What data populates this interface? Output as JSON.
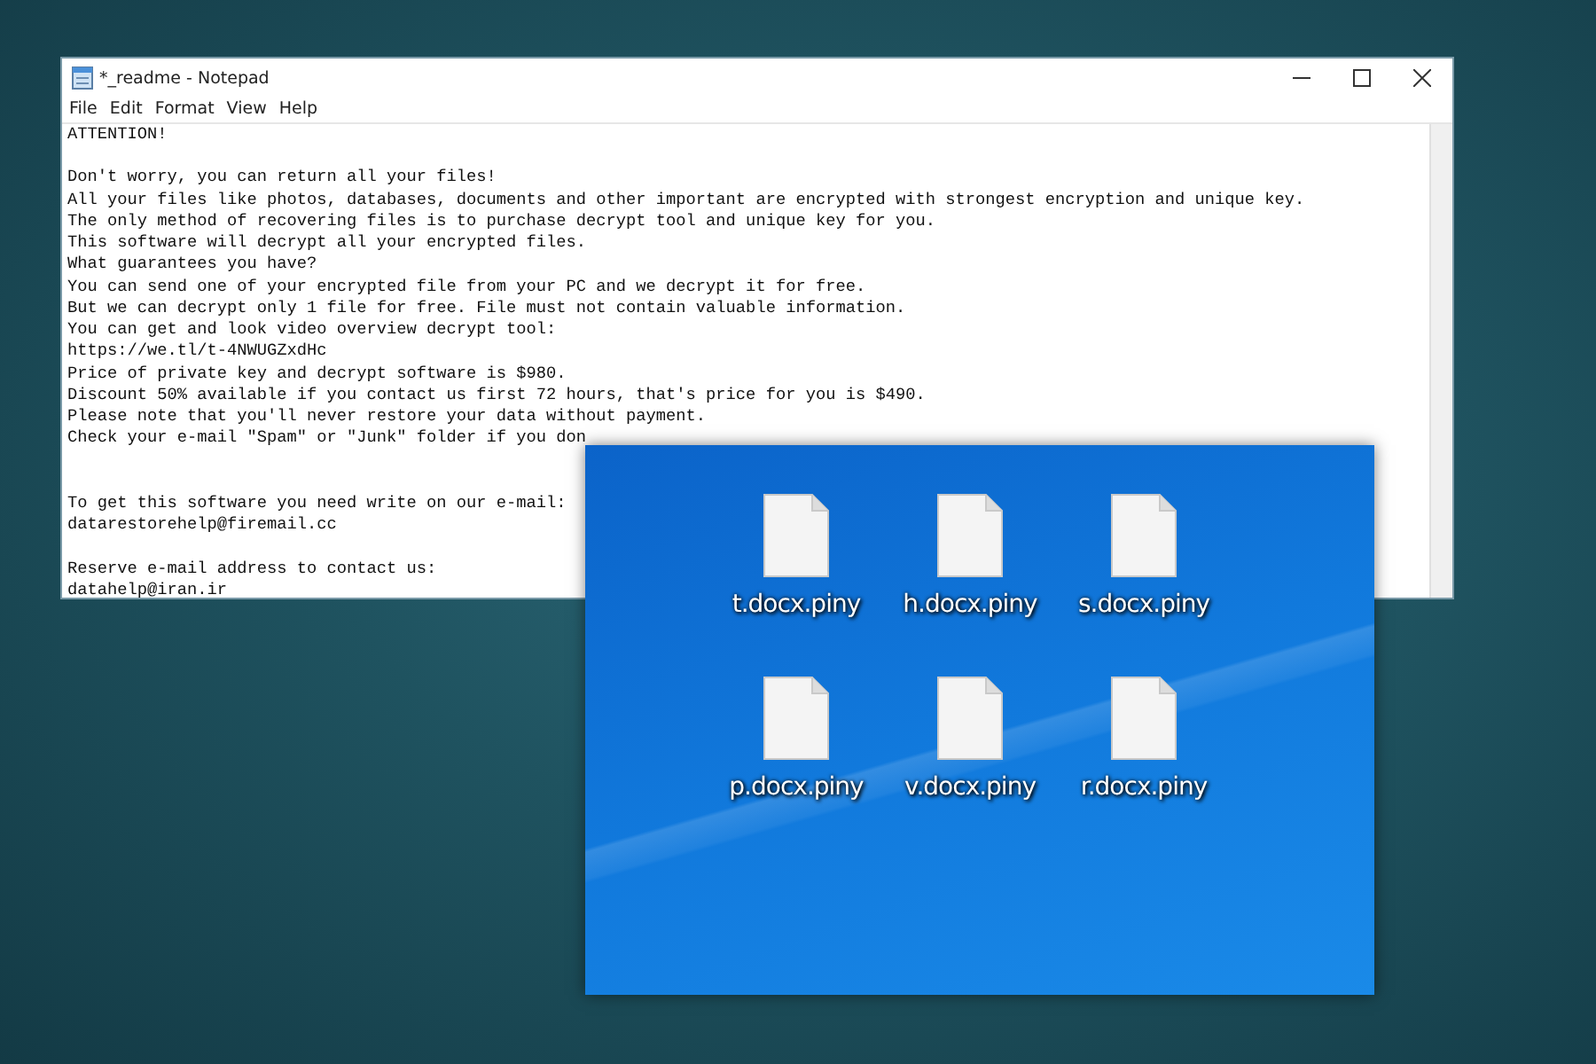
{
  "notepad": {
    "title": "*_readme - Notepad",
    "menu": [
      "File",
      "Edit",
      "Format",
      "View",
      "Help"
    ],
    "blocks": [
      {
        "lines": [
          "ATTENTION!"
        ]
      },
      {
        "lines": [
          "Don't worry, you can return all your files!",
          "All your files like photos, databases, documents and other important are encrypted with strongest encryption and unique key.",
          "The only method of recovering files is to purchase decrypt tool and unique key for you.",
          "This software will decrypt all your encrypted files.",
          "What guarantees you have?",
          "You can send one of your encrypted file from your PC and we decrypt it for free.",
          "But we can decrypt only 1 file for free. File must not contain valuable information.",
          "You can get and look video overview decrypt tool:",
          "https://we.tl/t-4NWUGZxdHc",
          "Price of private key and decrypt software is $980.",
          "Discount 50% available if you contact us first 72 hours, that's price for you is $490.",
          "Please note that you'll never restore your data without payment.",
          "Check your e-mail \"Spam\" or \"Junk\" folder if you don"
        ]
      },
      {
        "lines": [
          "To get this software you need write on our e-mail:",
          "datarestorehelp@firemail.cc"
        ]
      },
      {
        "lines": [
          "Reserve e-mail address to contact us:",
          "datahelp@iran.ir"
        ]
      }
    ]
  },
  "desktop": {
    "files": [
      {
        "name": "t.docx.piny"
      },
      {
        "name": "h.docx.piny"
      },
      {
        "name": "s.docx.piny"
      },
      {
        "name": "p.docx.piny"
      },
      {
        "name": "v.docx.piny"
      },
      {
        "name": "r.docx.piny"
      }
    ]
  }
}
